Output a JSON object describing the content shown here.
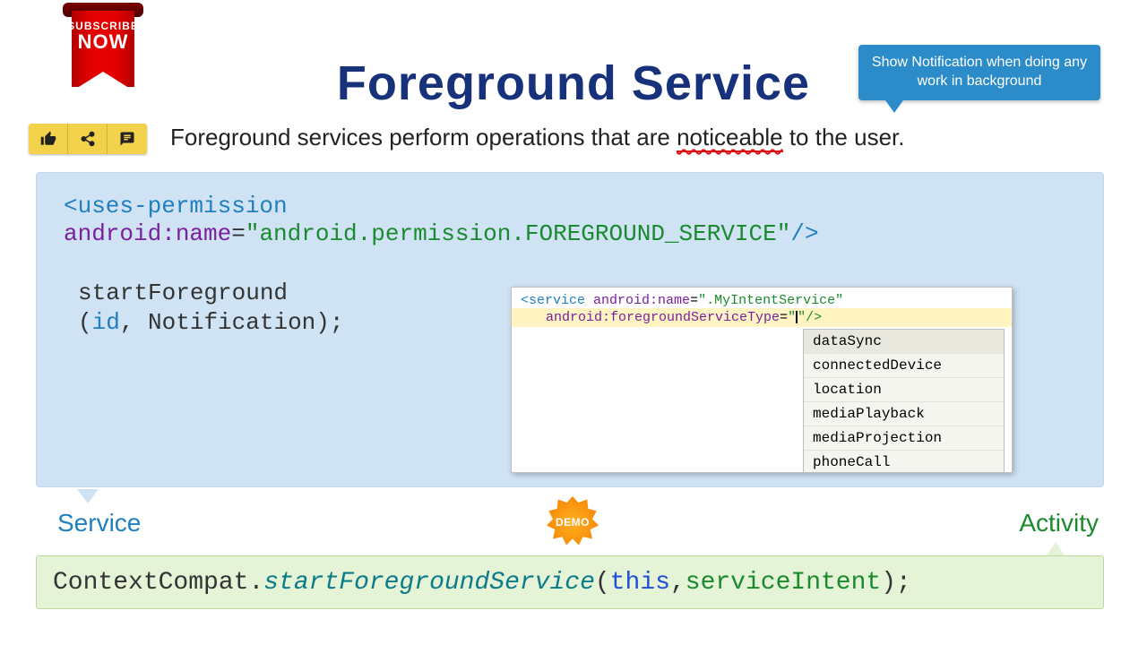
{
  "ribbon": {
    "line1": "SUBSCRIBE",
    "line2": "NOW"
  },
  "title": "Foreground Service",
  "callout": "Show Notification when doing any work in background",
  "subtitle_before": "Foreground services perform operations that are ",
  "subtitle_underlined": "noticeable",
  "subtitle_after": " to the user.",
  "permission": {
    "tag_open": "<uses-permission",
    "attr_name": "android:name",
    "eq": "=",
    "value": "\"android.permission.FOREGROUND_SERVICE\"",
    "tag_close": "/>"
  },
  "startfg": {
    "fn": "startForeground",
    "line2_open": "(",
    "id": "id",
    "comma": ",",
    "notif": " Notification",
    "close": ");"
  },
  "editor": {
    "l1_open": "<",
    "l1_tag": "service ",
    "l1_attr": "android:name",
    "l1_eq": "=",
    "l1_val": "\".MyIntentService\"",
    "l2_attr": "android:foregroundServiceType",
    "l2_eq": "=",
    "l2_q1": "\"",
    "l2_close": "\"/>"
  },
  "autocomplete": [
    "dataSync",
    "connectedDevice",
    "location",
    "mediaPlayback",
    "mediaProjection",
    "phoneCall"
  ],
  "label_service": "Service",
  "label_activity": "Activity",
  "demo": "DEMO",
  "activity_code": {
    "cls": "ContextCompat",
    "dot": ".",
    "method": "startForegroundService",
    "open": "(",
    "this": "this",
    "comma": ",",
    "arg": "serviceIntent",
    "close": ");"
  }
}
